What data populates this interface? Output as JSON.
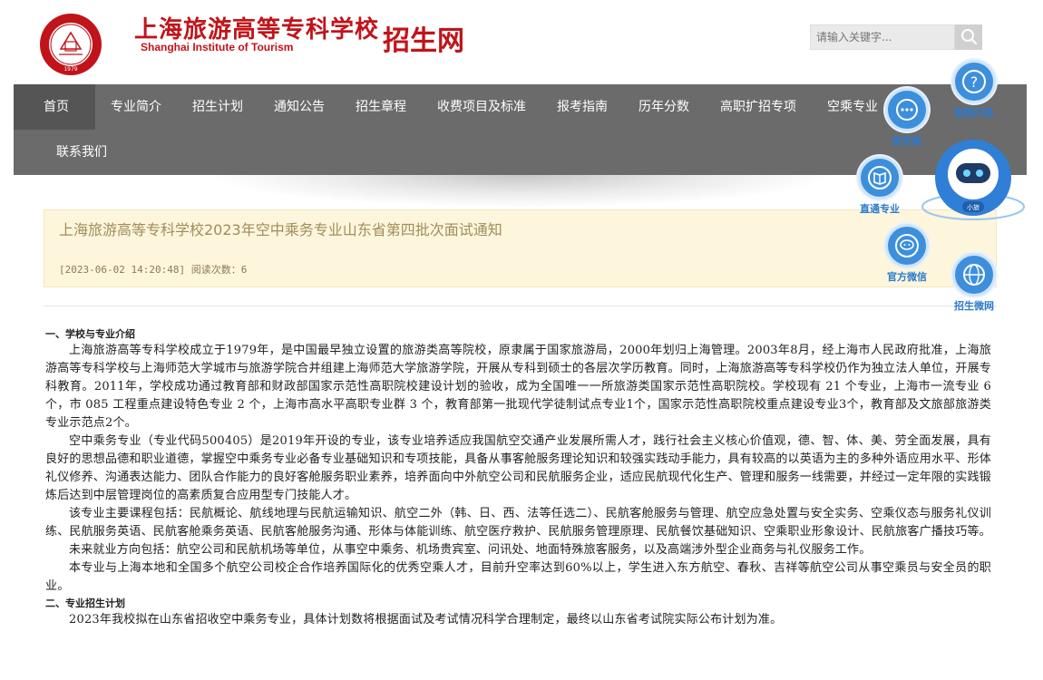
{
  "header": {
    "school_name_cn": "上海旅游高等专科学校",
    "school_name_en": "Shanghai Institute of Tourism",
    "site_name": "招生网",
    "logo_text": "SHANGHAI INSTITUTE OF TOURISM",
    "logo_year": "1979",
    "search": {
      "placeholder": "请输入关键字..."
    },
    "brand_color": "#c0141a"
  },
  "nav": {
    "items": [
      {
        "label": "首页",
        "active": true
      },
      {
        "label": "专业简介"
      },
      {
        "label": "招生计划"
      },
      {
        "label": "通知公告"
      },
      {
        "label": "招生章程"
      },
      {
        "label": "收费项目及标准"
      },
      {
        "label": "报考指南"
      },
      {
        "label": "历年分数"
      },
      {
        "label": "高职扩招专项"
      },
      {
        "label": "空乘专业"
      },
      {
        "label": "联系我们"
      }
    ]
  },
  "article": {
    "title": "上海旅游高等专科学校2023年空中乘务专业山东省第四批次面试通知",
    "meta": "[2023-06-02 14:20:48]  阅读次数：6",
    "section1_title": "一、学校与专业介绍",
    "p1": "上海旅游高等专科学校成立于1979年，是中国最早独立设置的旅游类高等院校，原隶属于国家旅游局，2000年划归上海管理。2003年8月，经上海市人民政府批准，上海旅游高等专科学校与上海师范大学城市与旅游学院合并组建上海师范大学旅游学院，开展从专科到硕士的各层次学历教育。同时，上海旅游高等专科学校仍作为独立法人单位，开展专科教育。2011年，学校成功通过教育部和财政部国家示范性高职院校建设计划的验收，成为全国唯一一所旅游类国家示范性高职院校。学校现有 21 个专业，上海市一流专业 6个，市 085 工程重点建设特色专业 2 个，上海市高水平高职专业群 3 个，教育部第一批现代学徒制试点专业1个，国家示范性高职院校重点建设专业3个，教育部及文旅部旅游类专业示范点2个。",
    "p2": "空中乘务专业（专业代码500405）是2019年开设的专业，该专业培养适应我国航空交通产业发展所需人才，践行社会主义核心价值观，德、智、体、美、劳全面发展，具有良好的思想品德和职业道德，掌握空中乘务专业必备专业基础知识和专项技能，具备从事客舱服务理论知识和较强实践动手能力，具有较高的以英语为主的多种外语应用水平、形体礼仪修养、沟通表达能力、团队合作能力的良好客舱服务职业素养，培养面向中外航空公司和民航服务企业，适应民航现代化生产、管理和服务一线需要，并经过一定年限的实践锻炼后达到中层管理岗位的高素质复合应用型专门技能人才。",
    "p3": "该专业主要课程包括：民航概论、航线地理与民航运输知识、航空二外（韩、日、西、法等任选二）、民航客舱服务与管理、航空应急处置与安全实务、空乘仪态与服务礼仪训练、民航服务英语、民航客舱乘务英语、民航客舱服务沟通、形体与体能训练、航空医疗救护、民航服务管理原理、民航餐饮基础知识、空乘职业形象设计、民航旅客广播技巧等。",
    "p4": "未来就业方向包括：航空公司和民航机场等单位，从事空中乘务、机场贵宾室、问讯处、地面特殊旅客服务，以及高端涉外型企业商务与礼仪服务工作。",
    "p5": "本专业与上海本地和全国多个航空公司校企合作培养国际化的优秀空乘人才，目前升空率达到60%以上，学生进入东方航空、春秋、吉祥等航空公司从事空乘员与安全员的职业。",
    "section2_title": "二、专业招生计划",
    "p6": "2023年我校拟在山东省招收空中乘务专业，具体计划数将根据面试及考试情况科学合理制定，最终以山东省考试院实际公布计划为准。"
  },
  "float_widgets": {
    "faq": "智能问答",
    "message": "留言板",
    "majors": "直通专业",
    "wechat": "官方微信",
    "weibo": "招生微网",
    "robot_badge": "小旅"
  }
}
